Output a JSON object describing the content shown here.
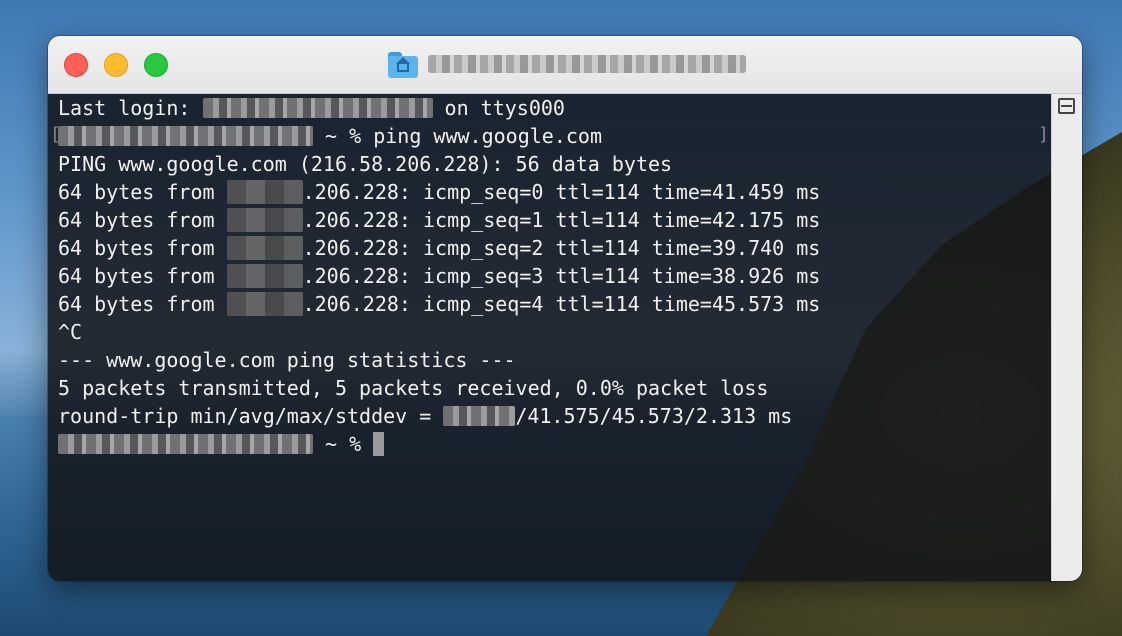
{
  "window": {
    "title_visible": false,
    "traffic_lights": [
      "close",
      "minimize",
      "zoom"
    ]
  },
  "terminal": {
    "lines": [
      {
        "pre": "Last login: ",
        "redact": "date",
        "post": " on ttys000"
      },
      {
        "pre": "",
        "redact": "host",
        "post": " ~ % ping www.google.com"
      },
      {
        "pre": "PING www.google.com (216.58.206.228): 56 data bytes",
        "redact": "",
        "post": ""
      },
      {
        "pre": "64 bytes from ",
        "redact": "ip",
        "post": ".206.228: icmp_seq=0 ttl=114 time=41.459 ms"
      },
      {
        "pre": "64 bytes from ",
        "redact": "ip",
        "post": ".206.228: icmp_seq=1 ttl=114 time=42.175 ms"
      },
      {
        "pre": "64 bytes from ",
        "redact": "ip",
        "post": ".206.228: icmp_seq=2 ttl=114 time=39.740 ms"
      },
      {
        "pre": "64 bytes from ",
        "redact": "ip",
        "post": ".206.228: icmp_seq=3 ttl=114 time=38.926 ms"
      },
      {
        "pre": "64 bytes from ",
        "redact": "ip",
        "post": ".206.228: icmp_seq=4 ttl=114 time=45.573 ms"
      },
      {
        "pre": "^C",
        "redact": "",
        "post": ""
      },
      {
        "pre": "--- www.google.com ping statistics ---",
        "redact": "",
        "post": ""
      },
      {
        "pre": "5 packets transmitted, 5 packets received, 0.0% packet loss",
        "redact": "",
        "post": ""
      },
      {
        "pre": "round-trip min/avg/max/stddev = ",
        "redact": "min",
        "post": "/41.575/45.573/2.313 ms"
      },
      {
        "pre": "",
        "redact": "host",
        "post": " ~ % ",
        "cursor": true
      }
    ]
  },
  "colors": {
    "close": "#fe5f57",
    "minimize": "#febc2e",
    "zoom": "#28c840",
    "terminal_text": "#f0f0f0",
    "terminal_bg": "#121418"
  },
  "icons": {
    "title_icon": "home-folder-icon",
    "split_pane": "split-pane-icon"
  }
}
